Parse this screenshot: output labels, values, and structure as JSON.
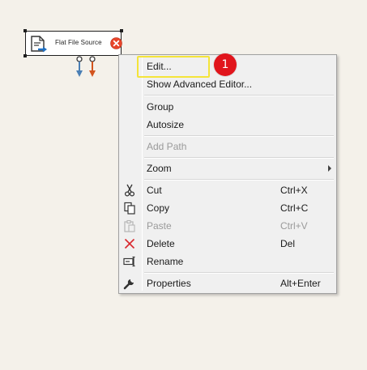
{
  "component": {
    "label": "Flat File Source",
    "icon": "flat-file-source-icon",
    "status_icon": "error-icon",
    "status_color": "#e8452b",
    "success_path_color": "#4a7fb5",
    "error_path_color": "#d2541e"
  },
  "context_menu": {
    "items": [
      {
        "label": "Edit...",
        "shortcut": "",
        "icon": "",
        "disabled": false
      },
      {
        "label": "Show Advanced Editor...",
        "shortcut": "",
        "icon": "",
        "disabled": false
      },
      {
        "label": "Group",
        "shortcut": "",
        "icon": "",
        "disabled": false
      },
      {
        "label": "Autosize",
        "shortcut": "",
        "icon": "",
        "disabled": false
      },
      {
        "label": "Add Path",
        "shortcut": "",
        "icon": "",
        "disabled": true
      },
      {
        "label": "Zoom",
        "shortcut": "",
        "icon": "",
        "disabled": false,
        "submenu": true
      },
      {
        "label": "Cut",
        "shortcut": "Ctrl+X",
        "icon": "scissors-icon",
        "disabled": false
      },
      {
        "label": "Copy",
        "shortcut": "Ctrl+C",
        "icon": "copy-icon",
        "disabled": false
      },
      {
        "label": "Paste",
        "shortcut": "Ctrl+V",
        "icon": "paste-icon",
        "disabled": true
      },
      {
        "label": "Delete",
        "shortcut": "Del",
        "icon": "delete-icon",
        "disabled": false
      },
      {
        "label": "Rename",
        "shortcut": "",
        "icon": "rename-icon",
        "disabled": false
      },
      {
        "label": "Properties",
        "shortcut": "Alt+Enter",
        "icon": "wrench-icon",
        "disabled": false
      }
    ]
  },
  "annotation": {
    "step_number": "1",
    "highlight_color": "#f4e43a",
    "badge_color": "#e1151c"
  }
}
